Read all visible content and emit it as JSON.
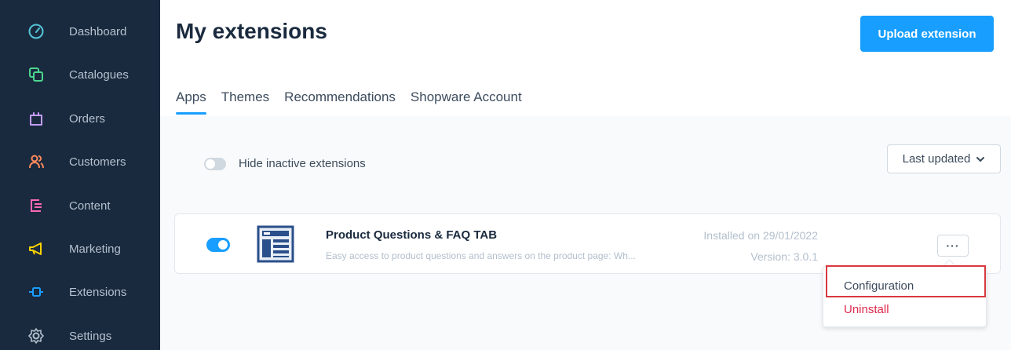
{
  "sidebar": {
    "items": [
      {
        "label": "Dashboard",
        "icon": "dashboard-icon",
        "color": "#54c7d8"
      },
      {
        "label": "Catalogues",
        "icon": "catalogues-icon",
        "color": "#4bd68f"
      },
      {
        "label": "Orders",
        "icon": "orders-icon",
        "color": "#c59cff"
      },
      {
        "label": "Customers",
        "icon": "customers-icon",
        "color": "#ff8a5c"
      },
      {
        "label": "Content",
        "icon": "content-icon",
        "color": "#ff68b4"
      },
      {
        "label": "Marketing",
        "icon": "marketing-icon",
        "color": "#ffd400"
      },
      {
        "label": "Extensions",
        "icon": "extensions-icon",
        "color": "#189eff"
      },
      {
        "label": "Settings",
        "icon": "settings-icon",
        "color": "#b4c0cf"
      }
    ]
  },
  "header": {
    "title": "My extensions",
    "upload_label": "Upload extension"
  },
  "tabs": [
    {
      "label": "Apps",
      "active": true
    },
    {
      "label": "Themes",
      "active": false
    },
    {
      "label": "Recommendations",
      "active": false
    },
    {
      "label": "Shopware Account",
      "active": false
    }
  ],
  "filters": {
    "hide_inactive_label": "Hide inactive extensions",
    "sort_label": "Last updated"
  },
  "extension": {
    "name": "Product Questions & FAQ TAB",
    "description": "Easy access to product questions and answers on the product page: Wh...",
    "installed": "Installed on 29/01/2022",
    "version": "Version: 3.0.1",
    "more_label": "···"
  },
  "context_menu": {
    "configuration": "Configuration",
    "uninstall": "Uninstall"
  },
  "colors": {
    "accent": "#189eff",
    "sidebar_bg": "#1a2a3e",
    "danger": "#de294c",
    "highlight": "#d9383f"
  }
}
